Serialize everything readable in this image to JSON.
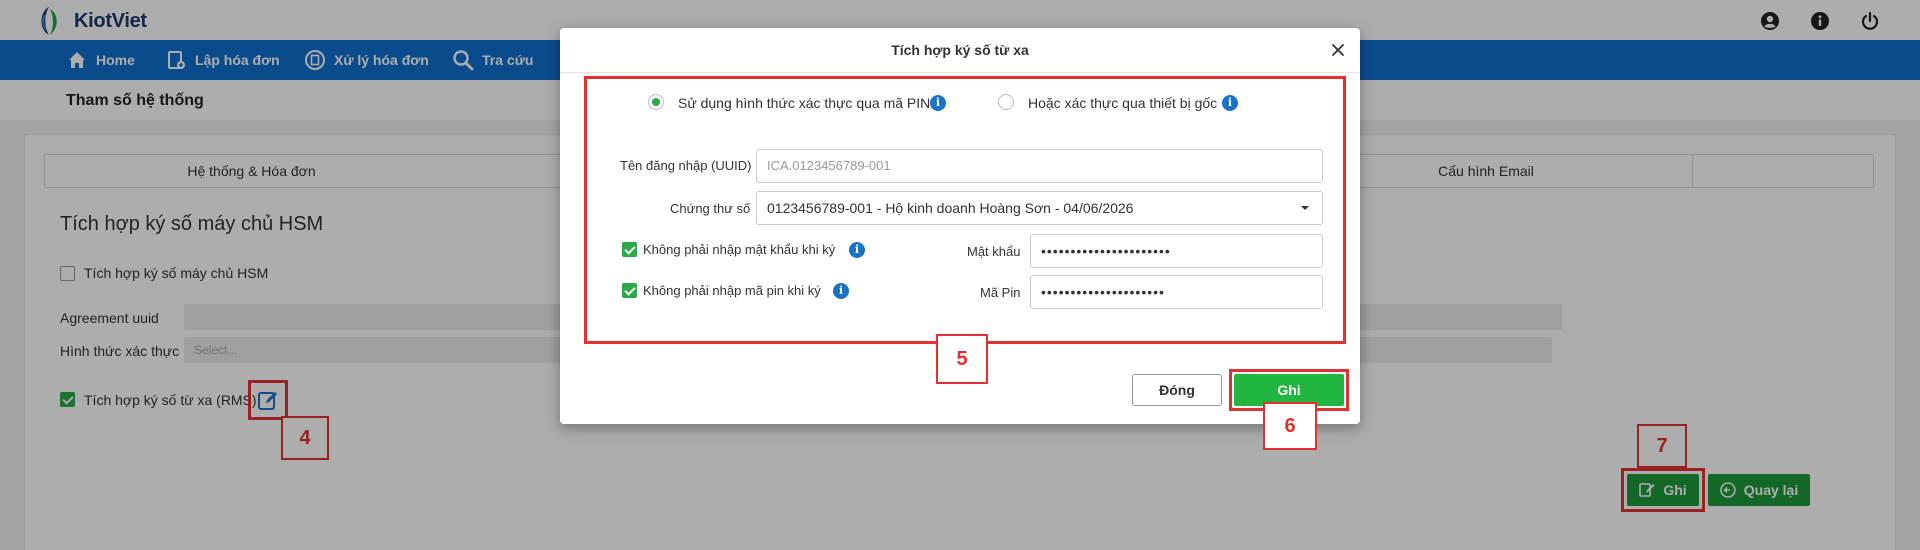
{
  "brand": {
    "name": "KiotViet",
    "primary_color": "#0f6fcf",
    "green": "#22b53f",
    "annotation_red": "#e03232"
  },
  "header_icons": [
    "user-circle-icon",
    "info-icon",
    "power-icon"
  ],
  "nav": [
    {
      "label": "Home",
      "icon": "home-icon"
    },
    {
      "label": "Lập hóa đơn",
      "icon": "invoice-create-icon"
    },
    {
      "label": "Xử lý hóa đơn",
      "icon": "invoice-process-icon"
    },
    {
      "label": "Tra cứu",
      "icon": "search-icon"
    }
  ],
  "page": {
    "title": "Tham số hệ thống"
  },
  "tabs": [
    {
      "label": "Hệ thống & Hóa đơn"
    },
    {
      "label": "Cấu hình Email"
    }
  ],
  "settings": {
    "section_title": "Tích hợp ký số máy chủ HSM",
    "hsm_checkbox": {
      "label": "Tích hợp ký số máy chủ HSM",
      "checked": false
    },
    "agreement_label": "Agreement uuid",
    "auth_label": "Hình thức xác thực",
    "auth_placeholder": "Select...",
    "rms_checkbox": {
      "label": "Tích hợp ký số từ xa (RMS)",
      "checked": true
    },
    "save_label": "Ghi",
    "back_label": "Quay lại"
  },
  "annotations": [
    "4",
    "5",
    "6",
    "7"
  ],
  "modal": {
    "title": "Tích hợp ký số từ xa",
    "radio_pin": {
      "label": "Sử dụng hình thức xác thực qua mã PIN",
      "selected": true
    },
    "radio_device": {
      "label": "Hoặc xác thực qua thiết bị gốc",
      "selected": false
    },
    "username_label": "Tên đăng nhập (UUID)",
    "username_placeholder": "ICA.0123456789-001",
    "cert_label": "Chứng thư số",
    "cert_value": "0123456789-001 - Hộ kinh doanh Hoàng Sơn - 04/06/2026",
    "no_password_checkbox": {
      "label": "Không phải nhập mật khẩu khi ký",
      "checked": true
    },
    "password_label": "Mật khẩu",
    "password_value": "••••••••••••••••••••••",
    "no_pin_checkbox": {
      "label": "Không phải nhập mã pin khi ký",
      "checked": true
    },
    "pin_label": "Mã Pin",
    "pin_value": "•••••••••••••••••••••",
    "close_label": "Đóng",
    "save_label": "Ghi"
  }
}
